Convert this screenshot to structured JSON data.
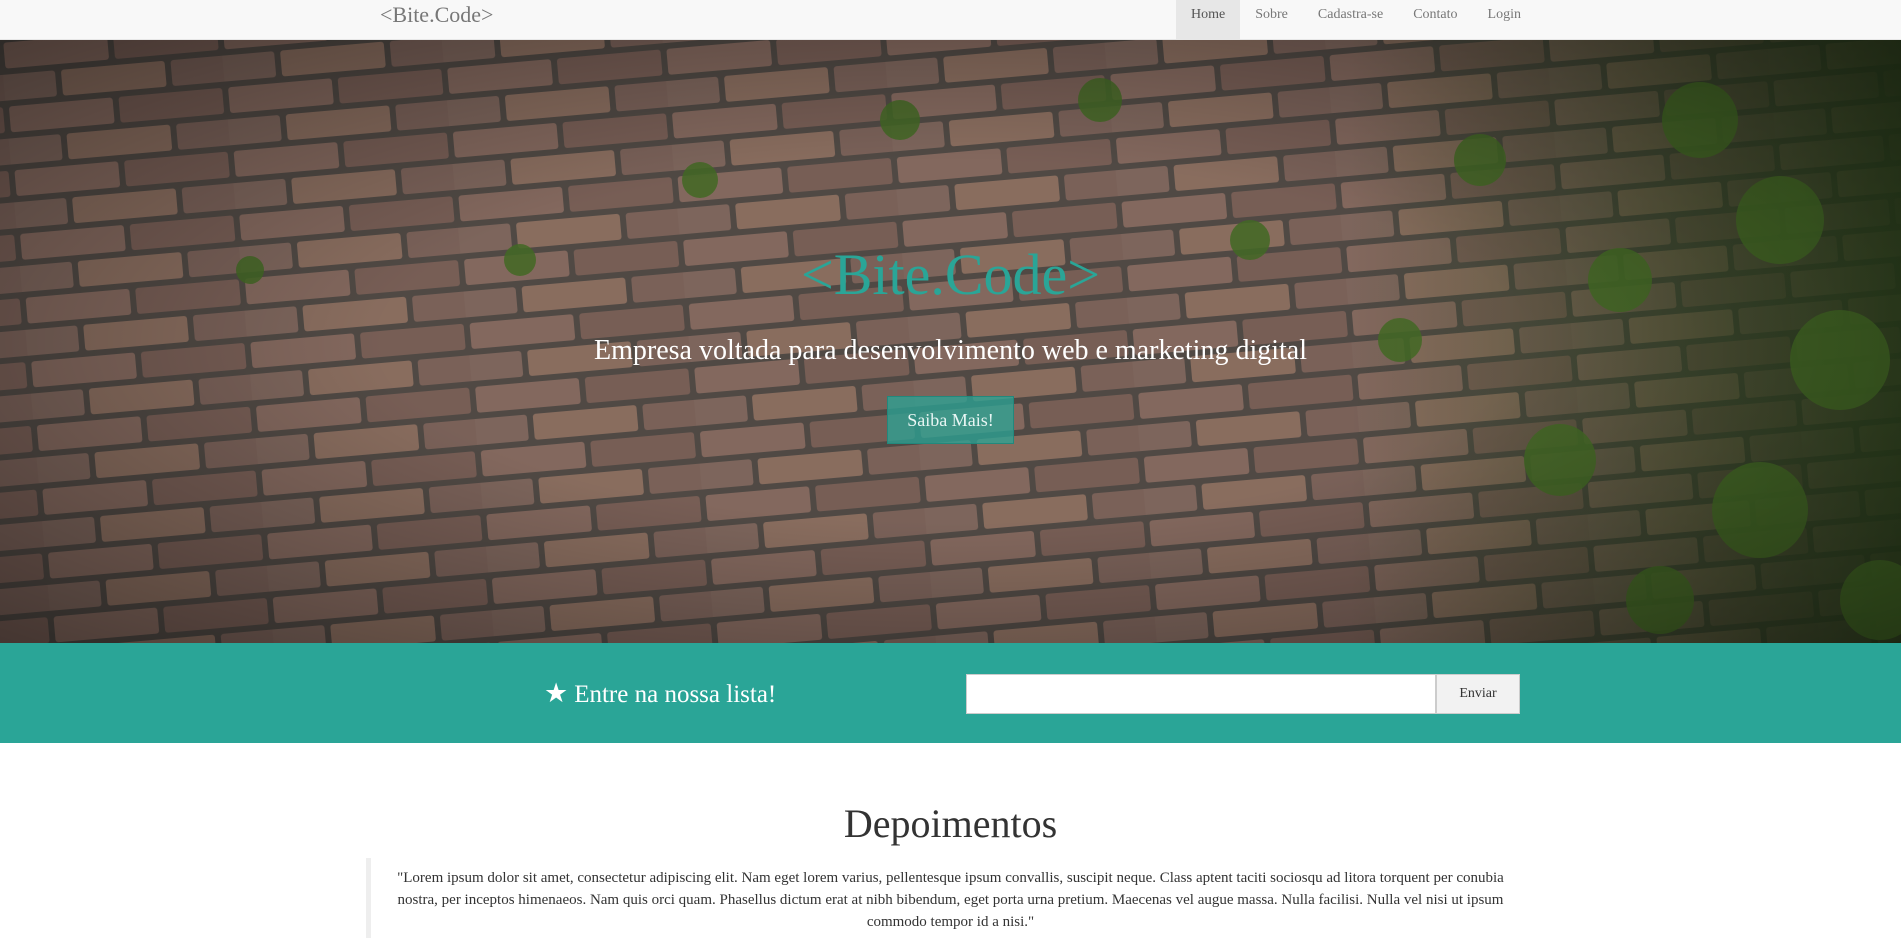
{
  "navbar": {
    "brand": "<Bite.Code>",
    "items": [
      {
        "label": "Home",
        "active": true
      },
      {
        "label": "Sobre",
        "active": false
      },
      {
        "label": "Cadastra-se",
        "active": false
      },
      {
        "label": "Contato",
        "active": false
      },
      {
        "label": "Login",
        "active": false
      }
    ]
  },
  "hero": {
    "title": "<Bite.Code>",
    "subtitle": "Empresa voltada para desenvolvimento web e marketing digital",
    "button_label": "Saiba Mais!",
    "background": "brick-wall-with-ivy"
  },
  "newsletter": {
    "icon": "star-icon",
    "label": "Entre na nossa lista!",
    "input_value": "",
    "button_label": "Enviar"
  },
  "testimonials": {
    "title": "Depoimentos",
    "quote": "\"Lorem ipsum dolor sit amet, consectetur adipiscing elit. Nam eget lorem varius, pellentesque ipsum convallis, suscipit neque. Class aptent taciti sociosqu ad litora torquent per conubia nostra, per inceptos himenaeos. Nam quis orci quam. Phasellus dictum erat at nibh bibendum, eget porta urna pretium. Maecenas vel augue massa. Nulla facilisi. Nulla vel nisi ut ipsum commodo tempor id a nisi.\""
  },
  "colors": {
    "accent": "#2aa597",
    "navbar_bg": "#f8f8f8",
    "nav_active_bg": "#e7e7e7"
  }
}
